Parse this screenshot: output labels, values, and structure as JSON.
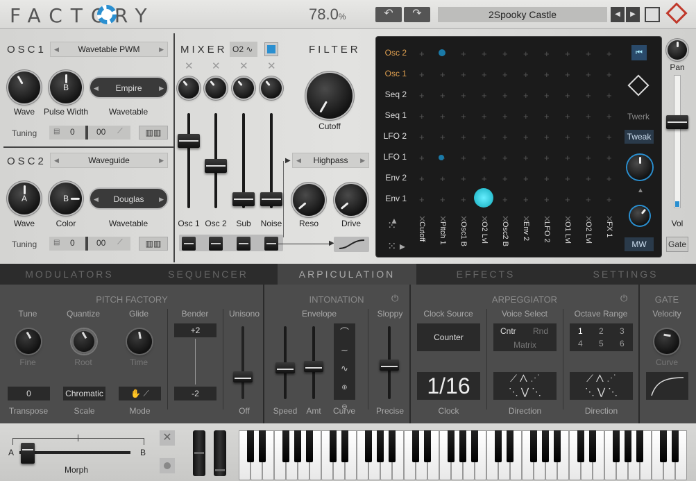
{
  "header": {
    "logo": "FACTORY",
    "zoom": "78.0",
    "zoom_unit": "%",
    "preset": "2Spooky Castle"
  },
  "osc1": {
    "title": "OSC1",
    "type": "Wavetable PWM",
    "k1": "Wave",
    "k2": "Pulse Width",
    "k2_letter": "B",
    "wt": "Empire",
    "wt_label": "Wavetable",
    "tuning": "Tuning",
    "t1": "0",
    "t2": "00"
  },
  "osc2": {
    "title": "OSC2",
    "type": "Waveguide",
    "k1": "Wave",
    "k1_letter": "A",
    "k2": "Color",
    "k2_letter": "B",
    "wt": "Douglas",
    "wt_label": "Wavetable",
    "tuning": "Tuning",
    "t1": "0",
    "t2": "00"
  },
  "mixer": {
    "title": "MIXER",
    "src": "O2",
    "ch": [
      "Osc 1",
      "Osc 2",
      "Sub",
      "Noise"
    ],
    "levels": [
      0.75,
      0.45,
      0.05,
      0.05
    ]
  },
  "filter": {
    "title": "FILTER",
    "cutoff": "Cutoff",
    "type": "Highpass",
    "reso": "Reso",
    "drive": "Drive"
  },
  "matrix": {
    "rows": [
      "Osc 2",
      "Osc 1",
      "Seq 2",
      "Seq 1",
      "LFO 2",
      "LFO 1",
      "Env 2",
      "Env 1"
    ],
    "cols": [
      "Cutoff",
      "Pitch 1",
      "Osc1 B",
      "O2 Lvl",
      "Osc2 B",
      "Env 2",
      "LFO 2",
      "O1 Lvl",
      "O2 Lvl",
      "FX 1"
    ],
    "twerk": "Twerk",
    "tweak": "Tweak",
    "mw": "MW"
  },
  "right": {
    "pan": "Pan",
    "vol": "Vol",
    "gate": "Gate"
  },
  "tabs": [
    "MODULATORS",
    "SEQUENCER",
    "ARPICULATION",
    "EFFECTS",
    "SETTINGS"
  ],
  "pitch": {
    "title": "PITCH FACTORY",
    "tune": "Tune",
    "fine": "Fine",
    "quantize": "Quantize",
    "root": "Root",
    "glide": "Glide",
    "time": "Time",
    "bender": "Bender",
    "b_up": "+2",
    "b_dn": "-2",
    "unisono": "Unisono",
    "off": "Off",
    "transpose_val": "0",
    "transpose": "Transpose",
    "scale_val": "Chromatic",
    "scale": "Scale",
    "mode": "Mode"
  },
  "inton": {
    "title": "INTONATION",
    "envelope": "Envelope",
    "sloppy": "Sloppy",
    "speed": "Speed",
    "amt": "Amt",
    "curve": "Curve",
    "precise": "Precise"
  },
  "arp": {
    "title": "ARPEGGIATOR",
    "clock_src": "Clock Source",
    "counter": "Counter",
    "voice_sel": "Voice Select",
    "cntr": "Cntr",
    "rnd": "Rnd",
    "matrix": "Matrix",
    "oct_range": "Octave Range",
    "octs": [
      "1",
      "2",
      "3",
      "4",
      "5",
      "6"
    ],
    "clock_val": "1/16",
    "clock": "Clock",
    "direction": "Direction",
    "direction2": "Direction"
  },
  "gate": {
    "title": "GATE",
    "velocity": "Velocity",
    "curve": "Curve"
  },
  "morph": {
    "a": "A",
    "b": "B",
    "label": "Morph"
  }
}
